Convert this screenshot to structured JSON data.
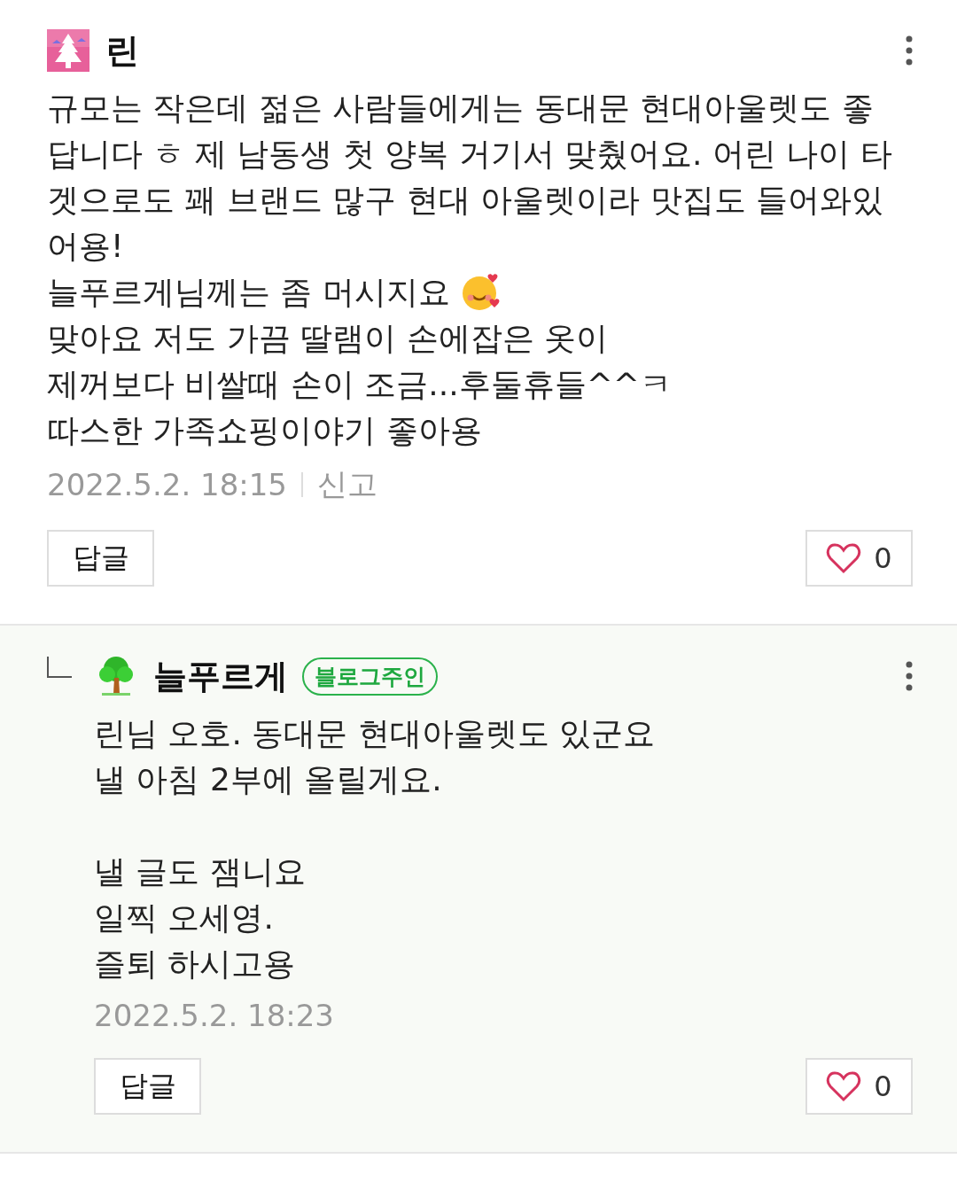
{
  "comments": [
    {
      "kind": "comment",
      "author": "린",
      "paragraphs": [
        [
          {
            "text": "규모는 작은데 젊은 사람들에게는 동대문 현대아울렛도 좋"
          },
          {
            "text": "답니다 ㅎ 제 남동생 첫 양복 거기서 맞췄어요. 어린 나이 타"
          },
          {
            "text": "겟으로도 꽤 브랜드 많구 현대 아울렛이라 맛집도 들어와있"
          },
          {
            "text": "어용!"
          },
          {
            "text": "늘푸르게님께는 좀 머시지요",
            "emoji": true
          },
          {
            "text": "맞아요 저도 가끔 딸램이 손에잡은 옷이"
          },
          {
            "text": "제꺼보다 비쌀때 손이 조금...후둘휴들^^ㅋ"
          },
          {
            "text": "따스한 가족쇼핑이야기 좋아용"
          }
        ]
      ],
      "time": "2022.5.2. 18:15",
      "report": "신고",
      "reply_button": "답글",
      "likes": "0"
    },
    {
      "kind": "reply",
      "author": "늘푸르게",
      "badge": "블로그주인",
      "paragraphs": [
        [
          {
            "text": "린님 오호. 동대문 현대아울렛도 있군요"
          },
          {
            "text": "낼 아침 2부에 올릴게요."
          }
        ],
        [
          {
            "text": "낼 글도 잼니요"
          },
          {
            "text": "일찍 오세영."
          },
          {
            "text": "즐퇴 하시고용"
          }
        ]
      ],
      "time": "2022.5.2. 18:23",
      "reply_button": "답글",
      "likes": "0"
    }
  ]
}
